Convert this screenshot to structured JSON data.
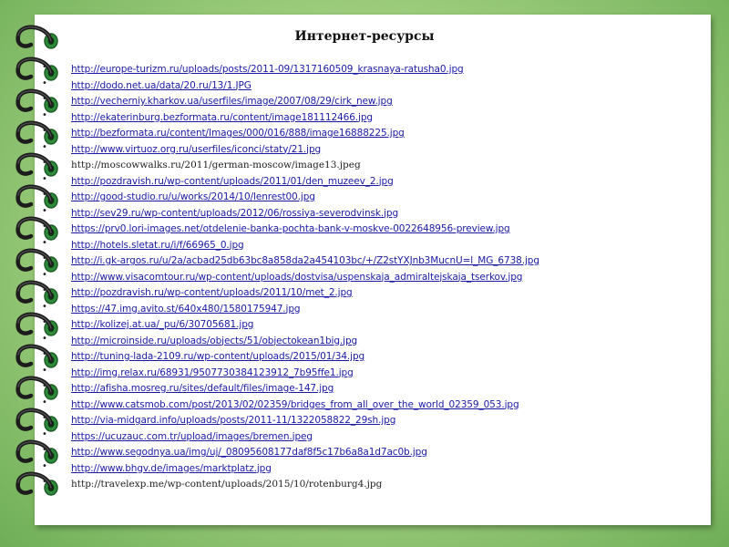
{
  "title": "Интернет-ресурсы",
  "resources": [
    {
      "text": "http://europe-turizm.ru/uploads/posts/2011-09/1317160509_krasnaya-ratusha0.jpg",
      "style": "link"
    },
    {
      "text": "http://dodo.net.ua/data/20.ru/13/1.JPG",
      "style": "link"
    },
    {
      "text": "http://vecherniy.kharkov.ua/userfiles/image/2007/08/29/cirk_new.jpg",
      "style": "link"
    },
    {
      "text": "http://ekaterinburg.bezformata.ru/content/image181112466.jpg",
      "style": "link"
    },
    {
      "text": "http://bezformata.ru/content/Images/000/016/888/image16888225.jpg",
      "style": "link"
    },
    {
      "text": "http://www.virtuoz.org.ru/userfiles/iconci/staty/21.jpg",
      "style": "link"
    },
    {
      "text": "http://moscowwalks.ru/2011/german-moscow/image13.jpeg",
      "style": "plain"
    },
    {
      "text": "http://pozdravish.ru/wp-content/uploads/2011/01/den_muzeev_2.jpg",
      "style": "link"
    },
    {
      "text": "http://good-studio.ru/u/works/2014/10/lenrest00.jpg",
      "style": "link"
    },
    {
      "text": "http://sev29.ru/wp-content/uploads/2012/06/rossiya-severodvinsk.jpg",
      "style": "link"
    },
    {
      "text": "https://prv0.lori-images.net/otdelenie-banka-pochta-bank-v-moskve-0022648956-preview.jpg",
      "style": "link"
    },
    {
      "text": "http://hotels.sletat.ru/i/f/66965_0.jpg",
      "style": "link"
    },
    {
      "text": "http://i.gk-argos.ru/u/2a/acbad25db63bc8a858da2a454103bc/+/Z2stYXJnb3MucnU=l_MG_6738.jpg",
      "style": "link"
    },
    {
      "text": "http://www.visacomtour.ru/wp-content/uploads/dostvisa/uspenskaja_admiraltejskaja_tserkov.jpg",
      "style": "link"
    },
    {
      "text": "http://pozdravish.ru/wp-content/uploads/2011/10/met_2.jpg",
      "style": "link"
    },
    {
      "text": "https://47.img.avito.st/640x480/1580175947.jpg",
      "style": "link"
    },
    {
      "text": "http://kolizej.at.ua/_pu/6/30705681.jpg",
      "style": "link"
    },
    {
      "text": "http://microinside.ru/uploads/objects/51/objectokean1big.jpg",
      "style": "link"
    },
    {
      "text": "http://tuning-lada-2109.ru/wp-content/uploads/2015/01/34.jpg",
      "style": "link"
    },
    {
      "text": "http://img.relax.ru/68931/9507730384123912_7b95ffe1.jpg",
      "style": "link"
    },
    {
      "text": "http://afisha.mosreg.ru/sites/default/files/image-147.jpg",
      "style": "link"
    },
    {
      "text": "http://www.catsmob.com/post/2013/02/02359/bridges_from_all_over_the_world_02359_053.jpg",
      "style": "link"
    },
    {
      "text": "http://via-midgard.info/uploads/posts/2011-11/1322058822_29sh.jpg",
      "style": "link"
    },
    {
      "text": "https://ucuzauc.com.tr/upload/images/bremen.jpeg",
      "style": "link"
    },
    {
      "text": "http://www.segodnya.ua/img/uj/_08095608177daf8f5c17b6a8a1d7ac0b.jpg",
      "style": "link"
    },
    {
      "text": "http://www.bhgv.de/images/marktplatz.jpg",
      "style": "link"
    },
    {
      "text": "http://travelexp.me/wp-content/uploads/2015/10/rotenburg4.jpg",
      "style": "plain"
    }
  ],
  "colors": {
    "link": "#1a1aa6",
    "background_green": "#9ccc7c",
    "ring_green": "#2e8b3a",
    "ring_dark": "#1c1c1c"
  },
  "icons": {
    "bullet": "bullet-dot-icon",
    "binder_ring": "binder-ring-icon"
  }
}
